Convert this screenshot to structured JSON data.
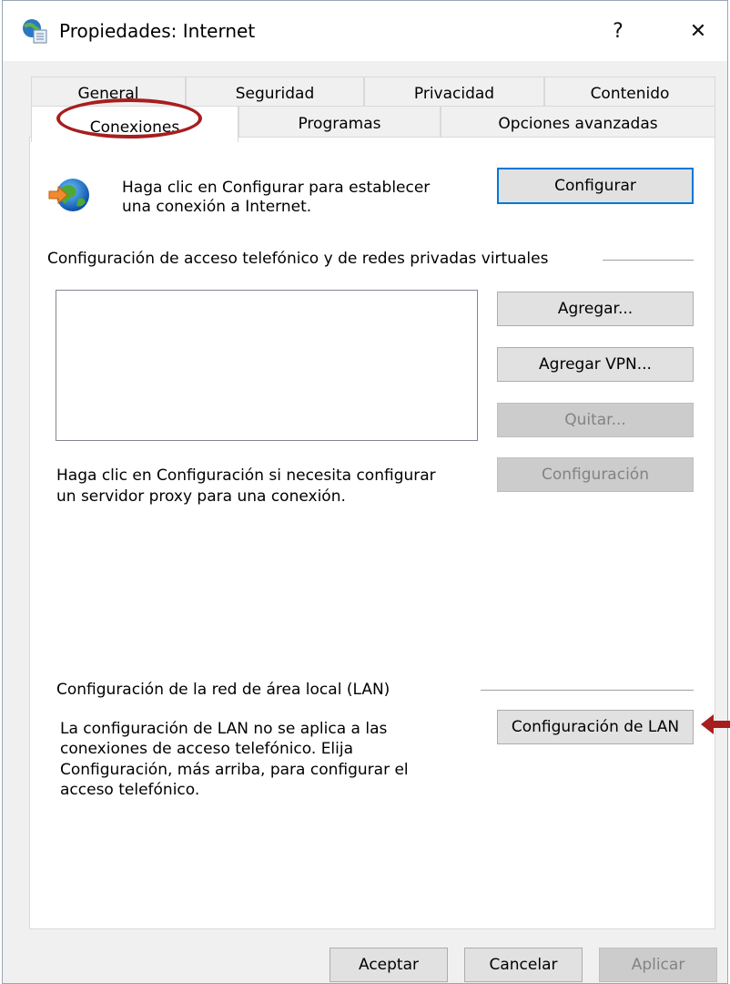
{
  "window": {
    "title": "Propiedades: Internet",
    "help_label": "?",
    "close_label": "✕"
  },
  "tabs": {
    "row1": [
      "General",
      "Seguridad",
      "Privacidad",
      "Contenido"
    ],
    "row2": [
      "Conexiones",
      "Programas",
      "Opciones avanzadas"
    ],
    "active": "Conexiones"
  },
  "setup": {
    "text_line1": "Haga clic en Configurar para establecer",
    "text_line2": "una conexión a Internet.",
    "button": "Configurar"
  },
  "dialup": {
    "heading": "Configuración de acceso telefónico y de redes privadas virtuales",
    "buttons": {
      "add": "Agregar...",
      "add_vpn": "Agregar VPN...",
      "remove": "Quitar...",
      "settings": "Configuración"
    },
    "proxy_line1": "Haga clic en Configuración si necesita configurar",
    "proxy_line2": "un servidor proxy para una conexión."
  },
  "lan": {
    "heading": "Configuración de la red de área local (LAN)",
    "line1": "La configuración de LAN no se aplica a las",
    "line2": "conexiones de acceso telefónico. Elija",
    "line3": "Configuración, más arriba, para configurar el",
    "line4": "acceso telefónico.",
    "button": "Configuración de LAN"
  },
  "footer": {
    "ok": "Aceptar",
    "cancel": "Cancelar",
    "apply": "Aplicar"
  },
  "colors": {
    "accent": "#0078d7",
    "annotation": "#a71e1e",
    "disabled_text": "#838383"
  },
  "icons": {
    "title": "internet-options-icon",
    "setup": "globe-connect-icon",
    "annotation": "red-arrow-icon"
  }
}
